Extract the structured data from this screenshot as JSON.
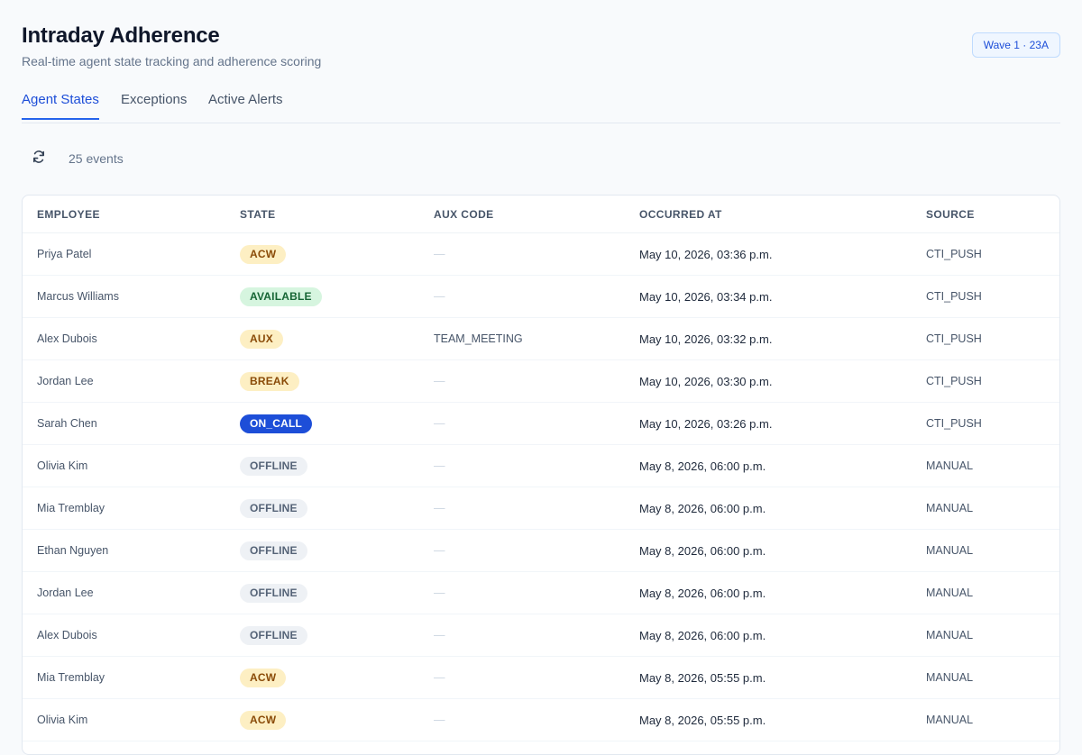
{
  "header": {
    "title": "Intraday Adherence",
    "subtitle": "Real-time agent state tracking and adherence scoring",
    "wave_badge": "Wave 1 · 23A"
  },
  "tabs": [
    {
      "label": "Agent States",
      "active": true
    },
    {
      "label": "Exceptions",
      "active": false
    },
    {
      "label": "Active Alerts",
      "active": false
    }
  ],
  "toolbar": {
    "refresh_icon": "refresh-icon",
    "event_count": "25 events"
  },
  "table": {
    "columns": [
      "EMPLOYEE",
      "STATE",
      "AUX CODE",
      "OCCURRED AT",
      "SOURCE"
    ],
    "rows": [
      {
        "employee": "Priya Patel",
        "state": "ACW",
        "aux_code": "—",
        "occurred_at": "May 10, 2026, 03:36 p.m.",
        "source": "CTI_PUSH"
      },
      {
        "employee": "Marcus Williams",
        "state": "AVAILABLE",
        "aux_code": "—",
        "occurred_at": "May 10, 2026, 03:34 p.m.",
        "source": "CTI_PUSH"
      },
      {
        "employee": "Alex Dubois",
        "state": "AUX",
        "aux_code": "TEAM_MEETING",
        "occurred_at": "May 10, 2026, 03:32 p.m.",
        "source": "CTI_PUSH"
      },
      {
        "employee": "Jordan Lee",
        "state": "BREAK",
        "aux_code": "—",
        "occurred_at": "May 10, 2026, 03:30 p.m.",
        "source": "CTI_PUSH"
      },
      {
        "employee": "Sarah Chen",
        "state": "ON_CALL",
        "aux_code": "—",
        "occurred_at": "May 10, 2026, 03:26 p.m.",
        "source": "CTI_PUSH"
      },
      {
        "employee": "Olivia Kim",
        "state": "OFFLINE",
        "aux_code": "—",
        "occurred_at": "May 8, 2026, 06:00 p.m.",
        "source": "MANUAL"
      },
      {
        "employee": "Mia Tremblay",
        "state": "OFFLINE",
        "aux_code": "—",
        "occurred_at": "May 8, 2026, 06:00 p.m.",
        "source": "MANUAL"
      },
      {
        "employee": "Ethan Nguyen",
        "state": "OFFLINE",
        "aux_code": "—",
        "occurred_at": "May 8, 2026, 06:00 p.m.",
        "source": "MANUAL"
      },
      {
        "employee": "Jordan Lee",
        "state": "OFFLINE",
        "aux_code": "—",
        "occurred_at": "May 8, 2026, 06:00 p.m.",
        "source": "MANUAL"
      },
      {
        "employee": "Alex Dubois",
        "state": "OFFLINE",
        "aux_code": "—",
        "occurred_at": "May 8, 2026, 06:00 p.m.",
        "source": "MANUAL"
      },
      {
        "employee": "Mia Tremblay",
        "state": "ACW",
        "aux_code": "—",
        "occurred_at": "May 8, 2026, 05:55 p.m.",
        "source": "MANUAL"
      },
      {
        "employee": "Olivia Kim",
        "state": "ACW",
        "aux_code": "—",
        "occurred_at": "May 8, 2026, 05:55 p.m.",
        "source": "MANUAL"
      }
    ]
  },
  "colors": {
    "accent": "#2563eb",
    "state_acw_bg": "#fdefc3",
    "state_available_bg": "#d6f5df",
    "state_on_call_bg": "#1d4ed8",
    "state_offline_bg": "#eef1f5"
  }
}
